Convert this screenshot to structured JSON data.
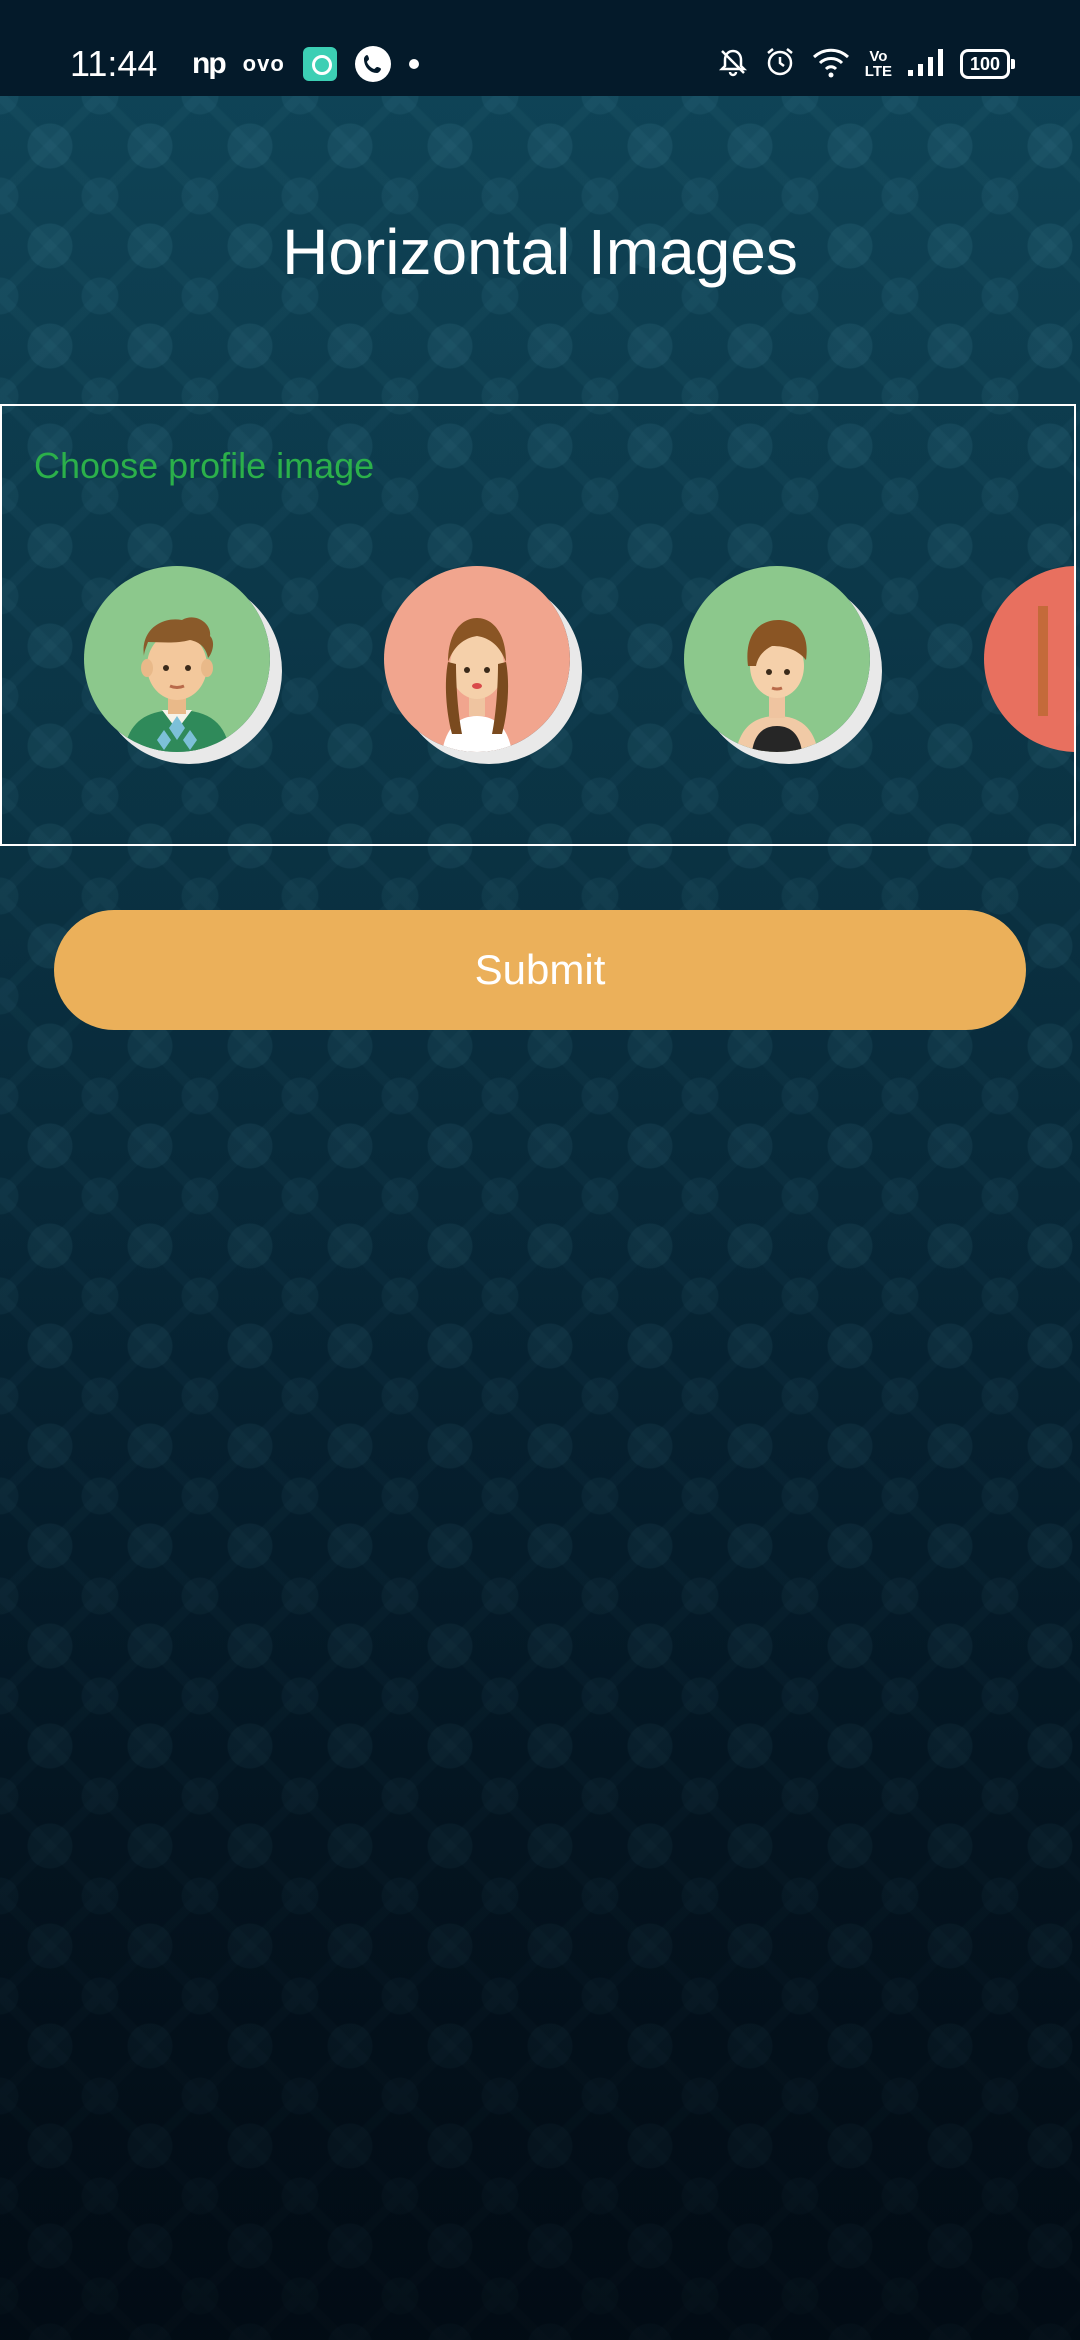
{
  "status_bar": {
    "time": "11:44",
    "app_icons": [
      "np-icon",
      "ovo-icon",
      "chat-app-icon",
      "phone-call-icon",
      "notification-dot-icon"
    ],
    "np_label": "np",
    "ovo_label": "ovo",
    "volte_line1": "Vo",
    "volte_line2": "LTE",
    "battery_level": "100"
  },
  "page": {
    "title": "Horizontal Images"
  },
  "picker": {
    "label": "Choose profile image",
    "avatars": [
      {
        "name": "avatar-man-sweater",
        "bg": "#8cc88c"
      },
      {
        "name": "avatar-woman-braids",
        "bg": "#f1a58e"
      },
      {
        "name": "avatar-woman-shorthair",
        "bg": "#8cc88c"
      },
      {
        "name": "avatar-partial",
        "bg": "#e8705f"
      }
    ]
  },
  "actions": {
    "submit_label": "Submit"
  },
  "colors": {
    "accent_button": "#ebb05a",
    "label_green": "#2bb04a",
    "status_bar_bg": "#041a2a"
  }
}
